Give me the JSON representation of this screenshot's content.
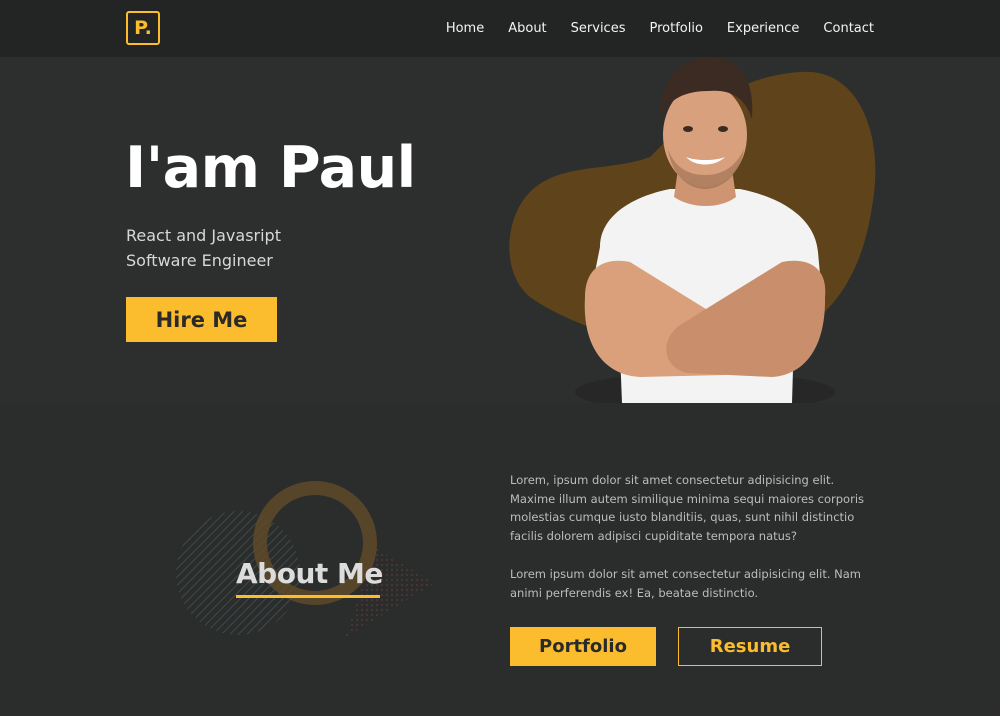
{
  "nav": {
    "logo": "P.",
    "links": [
      "Home",
      "About",
      "Services",
      "Protfolio",
      "Experience",
      "Contact"
    ]
  },
  "hero": {
    "title": "I'am Paul",
    "subtitle_line1": "React and Javasript",
    "subtitle_line2": "Software Engineer",
    "hire_button": "Hire Me"
  },
  "about": {
    "title": "About Me",
    "paragraph1": "Lorem, ipsum dolor sit amet consectetur adipisicing elit. Maxime illum autem similique minima sequi maiores corporis molestias cumque iusto blanditiis, quas, sunt nihil distinctio facilis dolorem adipisci cupiditate tempora natus?",
    "paragraph2": "Lorem ipsum dolor sit amet consectetur adipisicing elit. Nam animi perferendis ex! Ea, beatae distinctio.",
    "portfolio_button": "Portfolio",
    "resume_button": "Resume"
  },
  "colors": {
    "accent": "#fbbd2e",
    "background": "#2b2c2c",
    "nav_background": "#232424"
  }
}
